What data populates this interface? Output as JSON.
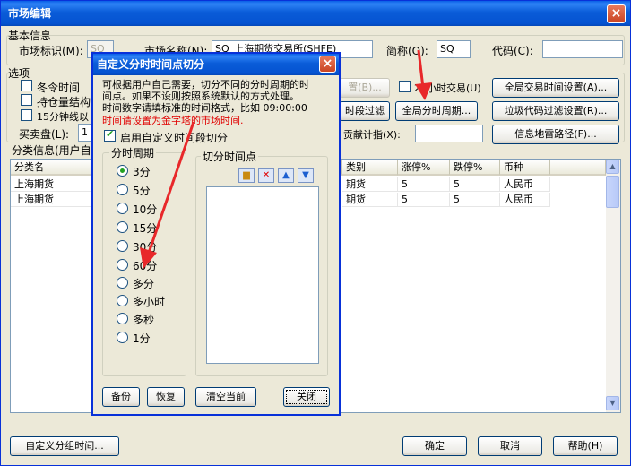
{
  "window": {
    "title": "市场编辑",
    "close_glyph": "×"
  },
  "basic_info": {
    "section_label": "基本信息",
    "market_id_label": "市场标识(M):",
    "market_id_value": "SQ",
    "market_name_label": "市场名称(N):",
    "market_name_value": "SQ_上海期货交易所(SHFE)",
    "short_name_label": "简称(O):",
    "short_name_value": "SQ",
    "code_label": "代码(C):",
    "code_value": ""
  },
  "options": {
    "section_label": "选项",
    "winter_time_label": "冬令时间",
    "position_structure_label": "持仓量结构",
    "k15_label": "15分钟线以",
    "settings_btn": "置(B)...",
    "hours24_label": "24小时交易(U)",
    "global_trade_time_btn": "全局交易时间设置(A)...",
    "session_filter_btn": "时段过滤",
    "global_period_btn": "全局分时周期...",
    "junk_filter_btn": "垃圾代码过滤设置(R)...",
    "buysell_label": "买卖盘(L):",
    "buysell_value": "1",
    "contrib_label": "贡献计指(X):",
    "contrib_value": "",
    "mine_path_btn": "信息地雷路径(F)..."
  },
  "category": {
    "section_label": "分类信息(用户自定义分类)",
    "headers": [
      "分类名",
      "类别",
      "涨停%",
      "跌停%",
      "币种"
    ],
    "rows": [
      [
        "上海期货",
        "期货",
        "5",
        "5",
        "人民币"
      ],
      [
        "上海期货",
        "期货",
        "5",
        "5",
        "人民币"
      ]
    ]
  },
  "footer": {
    "custom_group_btn": "自定义分组时间...",
    "ok_btn": "确定",
    "cancel_btn": "取消",
    "help_btn": "帮助(H)"
  },
  "dialog": {
    "title": "自定义分时时间点切分",
    "close_glyph": "×",
    "desc_line1": "可根据用户自己需要，切分不同的分时周期的时",
    "desc_line2": "间点。如果不设则按照系统默认的方式处理。",
    "desc_line3": "时间数字请填标准的时间格式，比如 09:00:00",
    "warning": "时间请设置为金字塔的市场时间.",
    "enable_label": "启用自定义时间段切分",
    "period_group_label": "分时周期",
    "periods": [
      "3分",
      "5分",
      "10分",
      "15分",
      "30分",
      "60分",
      "多分",
      "多小时",
      "多秒",
      "1分"
    ],
    "selected_period": "3分",
    "split_group_label": "切分时间点",
    "backup_btn": "备份",
    "restore_btn": "恢复",
    "clear_btn": "清空当前",
    "close_btn": "关闭"
  },
  "colors": {
    "titlebar": "#0553d1",
    "face": "#ece9d8",
    "warning": "#e00000",
    "arrow": "#e8282a"
  }
}
